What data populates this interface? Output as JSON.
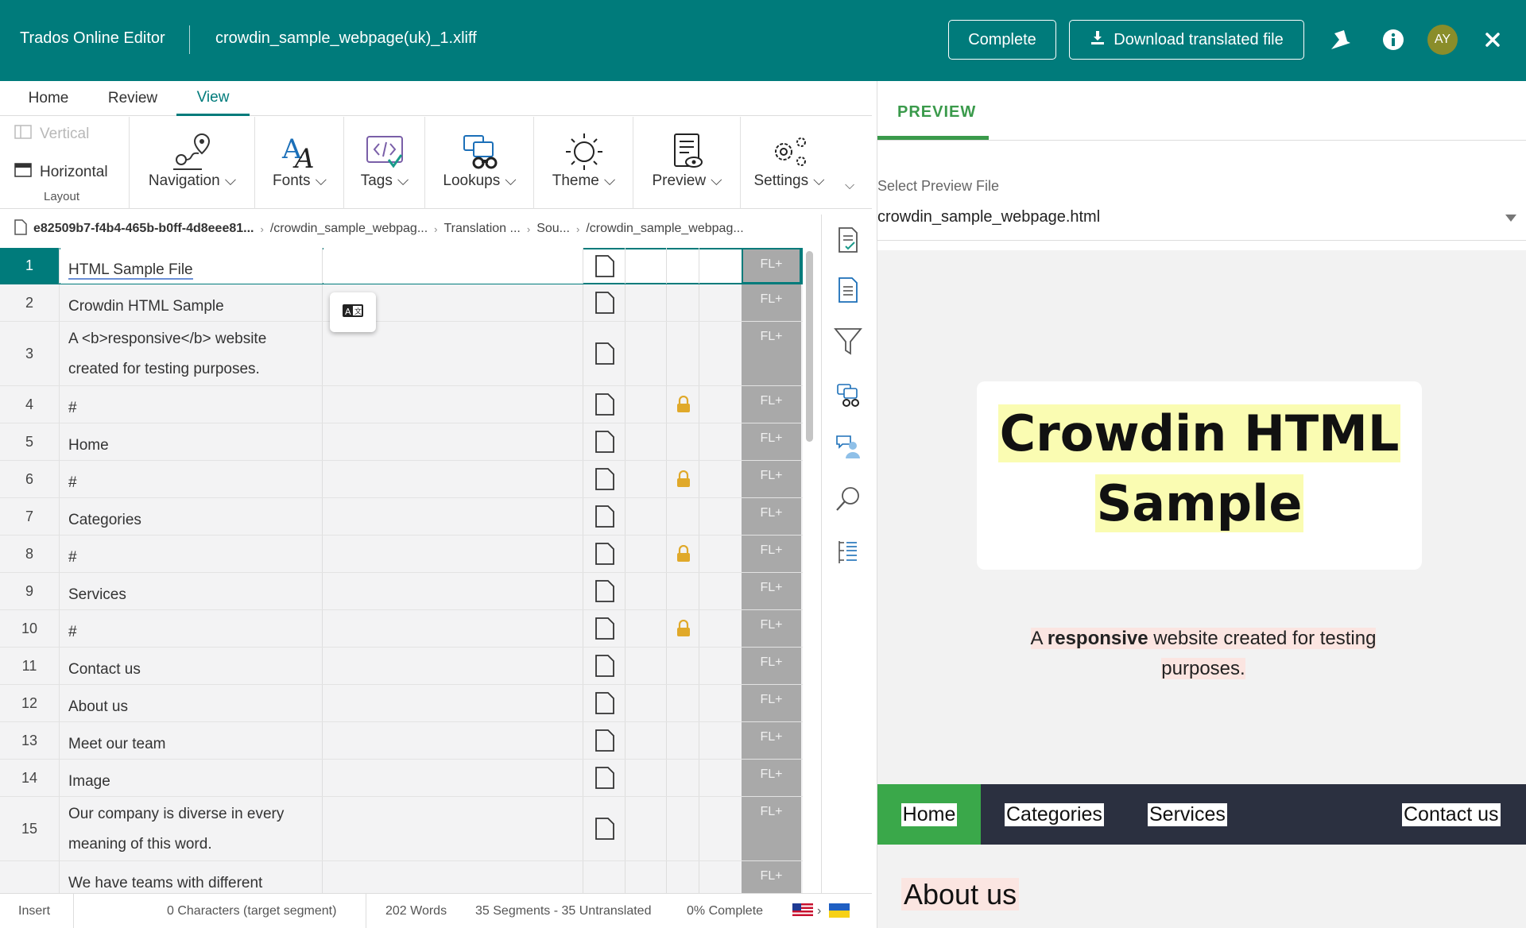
{
  "header": {
    "app_title": "Trados Online Editor",
    "file_name": "crowdin_sample_webpage(uk)_1.xliff",
    "complete_label": "Complete",
    "download_label": "Download translated file",
    "avatar_initials": "AY"
  },
  "tabs": [
    {
      "label": "Home"
    },
    {
      "label": "Review"
    },
    {
      "label": "View"
    }
  ],
  "ribbon": {
    "layout": {
      "vertical": "Vertical",
      "horizontal": "Horizontal",
      "caption": "Layout"
    },
    "groups": [
      {
        "label": "Navigation",
        "icon": "navigation-icon"
      },
      {
        "label": "Fonts",
        "icon": "fonts-icon"
      },
      {
        "label": "Tags",
        "icon": "tags-icon"
      },
      {
        "label": "Lookups",
        "icon": "lookups-icon"
      },
      {
        "label": "Theme",
        "icon": "theme-icon"
      },
      {
        "label": "Preview",
        "icon": "preview-icon"
      },
      {
        "label": "Settings",
        "icon": "settings-icon"
      }
    ]
  },
  "breadcrumb": [
    "e82509b7-f4b4-465b-b0ff-4d8eee81...",
    "/crowdin_sample_webpag...",
    "Translation ...",
    "Sou...",
    "/crowdin_sample_webpag..."
  ],
  "segments": [
    {
      "num": "1",
      "source": "HTML Sample File",
      "locked": false,
      "status": "FL+"
    },
    {
      "num": "2",
      "source": "Crowdin HTML Sample",
      "locked": false,
      "status": "FL+"
    },
    {
      "num": "3",
      "source_line1": "A <b>responsive</b> website",
      "source_line2": "created for testing purposes.",
      "locked": false,
      "status": "FL+"
    },
    {
      "num": "4",
      "source": "#",
      "locked": true,
      "status": "FL+"
    },
    {
      "num": "5",
      "source": "Home",
      "locked": false,
      "status": "FL+"
    },
    {
      "num": "6",
      "source": "#",
      "locked": true,
      "status": "FL+"
    },
    {
      "num": "7",
      "source": "Categories",
      "locked": false,
      "status": "FL+"
    },
    {
      "num": "8",
      "source": "#",
      "locked": true,
      "status": "FL+"
    },
    {
      "num": "9",
      "source": "Services",
      "locked": false,
      "status": "FL+"
    },
    {
      "num": "10",
      "source": "#",
      "locked": true,
      "status": "FL+"
    },
    {
      "num": "11",
      "source": "Contact us",
      "locked": false,
      "status": "FL+"
    },
    {
      "num": "12",
      "source": "About us",
      "locked": false,
      "status": "FL+"
    },
    {
      "num": "13",
      "source": "Meet our team",
      "locked": false,
      "status": "FL+"
    },
    {
      "num": "14",
      "source": "Image",
      "locked": false,
      "status": "FL+"
    },
    {
      "num": "15",
      "source_line1": "Our company is diverse in every",
      "source_line2": "meaning of this word.",
      "locked": false,
      "status": "FL+"
    },
    {
      "num": "",
      "source": "We have teams with different",
      "locked": false,
      "status": "FL+"
    }
  ],
  "status_bar": {
    "mode": "Insert",
    "characters": "0 Characters (target segment)",
    "words": "202 Words",
    "segments": "35 Segments - 35 Untranslated",
    "complete": "0% Complete"
  },
  "preview": {
    "tab_label": "PREVIEW",
    "select_label": "Select Preview File",
    "selected_file": "crowdin_sample_webpage.html",
    "page": {
      "heading_line1": "Crowdin HTML",
      "heading_line2": "Sample",
      "desc_prefix": "A ",
      "desc_bold": "responsive",
      "desc_mid": " website created for testing",
      "desc_end": "purposes.",
      "nav": [
        "Home",
        "Categories",
        "Services",
        "Contact us"
      ],
      "about": "About us"
    }
  },
  "colors": {
    "header_bg": "#007b7b",
    "accent_green": "#3a9a4b",
    "status_fill": "#a9a9a9",
    "nav_bg": "#2b3040"
  }
}
